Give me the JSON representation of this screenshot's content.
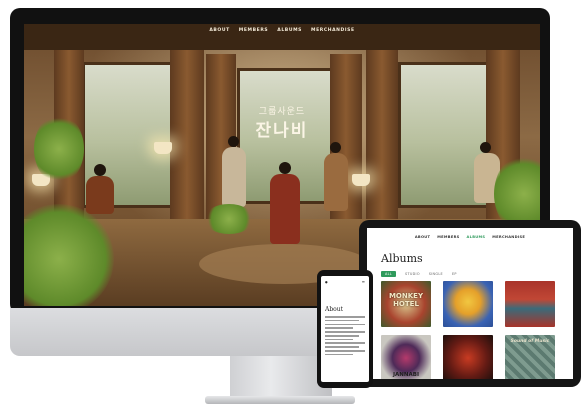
{
  "desktop": {
    "nav": [
      "ABOUT",
      "MEMBERS",
      "ALBUMS",
      "MERCHANDISE"
    ],
    "hero_subtitle": "그룹사운드",
    "hero_title": "잔나비"
  },
  "tablet": {
    "nav": [
      "ABOUT",
      "MEMBERS",
      "ALBUMS",
      "MERCHANDISE"
    ],
    "active_nav": "ALBUMS",
    "page_title": "Albums",
    "filters": [
      "ALL",
      "STUDIO",
      "SINGLE",
      "EP"
    ],
    "selected_filter": "ALL",
    "albums": [
      {
        "title_text": "MONKEY HOTEL"
      },
      {
        "title_text": ""
      },
      {
        "title_text": ""
      },
      {
        "title_text": "JANNABI"
      },
      {
        "title_text": ""
      },
      {
        "title_text": "Sound of Music"
      }
    ]
  },
  "phone": {
    "page_title": "About"
  },
  "colors": {
    "accent": "#2f9a5c",
    "device_frame": "#111111",
    "monitor_body": "#d4d5d8"
  }
}
